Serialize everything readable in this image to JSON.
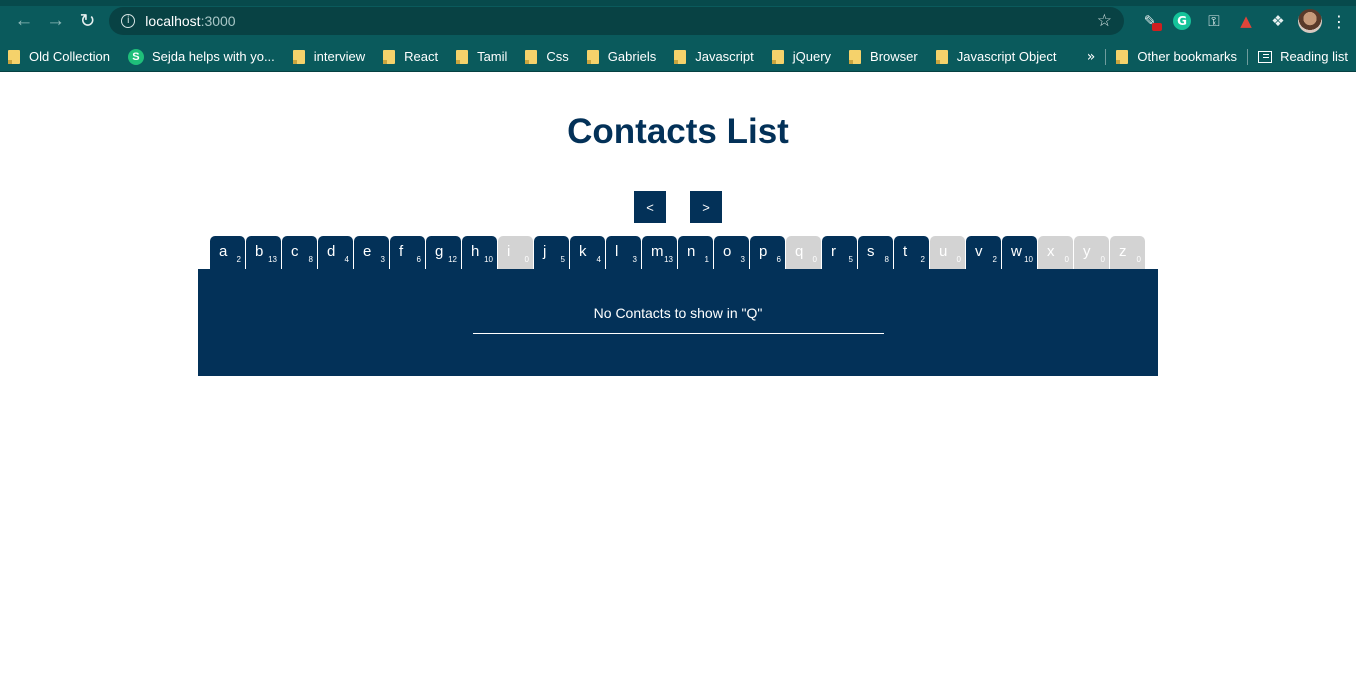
{
  "browser": {
    "url_host": "localhost",
    "url_port": ":3000",
    "bookmarks": [
      {
        "label": "Old Collection",
        "icon": "folder-icon"
      },
      {
        "label": "Sejda helps with yo...",
        "icon": "sejda-icon"
      },
      {
        "label": "interview",
        "icon": "folder-icon"
      },
      {
        "label": "React",
        "icon": "folder-icon"
      },
      {
        "label": "Tamil",
        "icon": "folder-icon"
      },
      {
        "label": "Css",
        "icon": "folder-icon"
      },
      {
        "label": "Gabriels",
        "icon": "folder-icon"
      },
      {
        "label": "Javascript",
        "icon": "folder-icon"
      },
      {
        "label": "jQuery",
        "icon": "folder-icon"
      },
      {
        "label": "Browser",
        "icon": "folder-icon"
      },
      {
        "label": "Javascript Object",
        "icon": "folder-icon"
      }
    ],
    "overflow_label": "»",
    "other_bookmarks": "Other bookmarks",
    "reading_list": "Reading list",
    "grammarly_letter": "G",
    "sejda_letter": "S"
  },
  "page": {
    "title": "Contacts List",
    "prev_label": "<",
    "next_label": ">",
    "empty_message": "No Contacts to show in \"Q\"",
    "accent_color": "#033158",
    "disabled_color": "#d3d3d3"
  },
  "tabs": [
    {
      "letter": "a",
      "count": "2"
    },
    {
      "letter": "b",
      "count": "13"
    },
    {
      "letter": "c",
      "count": "8"
    },
    {
      "letter": "d",
      "count": "4"
    },
    {
      "letter": "e",
      "count": "3"
    },
    {
      "letter": "f",
      "count": "6"
    },
    {
      "letter": "g",
      "count": "12"
    },
    {
      "letter": "h",
      "count": "10"
    },
    {
      "letter": "i",
      "count": "0"
    },
    {
      "letter": "j",
      "count": "5"
    },
    {
      "letter": "k",
      "count": "4"
    },
    {
      "letter": "l",
      "count": "3"
    },
    {
      "letter": "m",
      "count": "13"
    },
    {
      "letter": "n",
      "count": "1"
    },
    {
      "letter": "o",
      "count": "3"
    },
    {
      "letter": "p",
      "count": "6"
    },
    {
      "letter": "q",
      "count": "0"
    },
    {
      "letter": "r",
      "count": "5"
    },
    {
      "letter": "s",
      "count": "8"
    },
    {
      "letter": "t",
      "count": "2"
    },
    {
      "letter": "u",
      "count": "0"
    },
    {
      "letter": "v",
      "count": "2"
    },
    {
      "letter": "w",
      "count": "10"
    },
    {
      "letter": "x",
      "count": "0"
    },
    {
      "letter": "y",
      "count": "0"
    },
    {
      "letter": "z",
      "count": "0"
    }
  ]
}
